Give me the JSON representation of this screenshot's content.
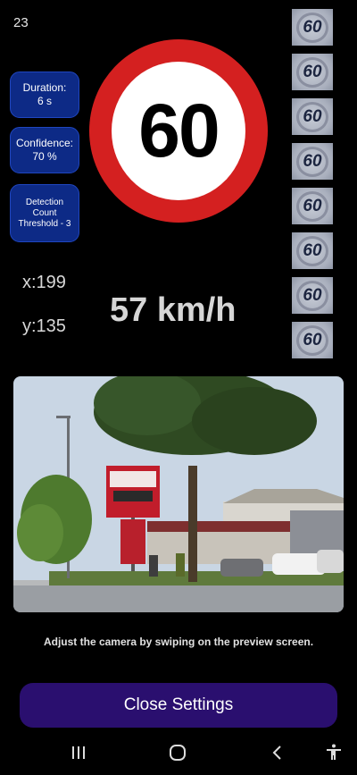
{
  "status": {
    "counter": "23"
  },
  "settings": {
    "duration": {
      "label": "Duration:",
      "value": "6 s"
    },
    "confidence": {
      "label": "Confidence:",
      "value": "70 %"
    },
    "threshold": {
      "line1": "Detection",
      "line2": "Count",
      "line3": "Threshold - 3"
    }
  },
  "sign": {
    "limit": "60",
    "border_color": "#d42020"
  },
  "position": {
    "x": "x:199",
    "y": "y:135"
  },
  "speed": {
    "text": "57 km/h"
  },
  "detections": [
    "60",
    "60",
    "60",
    "60",
    "60",
    "60",
    "60",
    "60"
  ],
  "camera": {
    "hint": "Adjust the camera by swiping on the preview screen."
  },
  "actions": {
    "close_label": "Close Settings",
    "close_color": "#2a0f6f"
  },
  "navbar": {
    "icons": [
      "recent-apps-icon",
      "home-icon",
      "back-icon",
      "accessibility-icon"
    ]
  }
}
